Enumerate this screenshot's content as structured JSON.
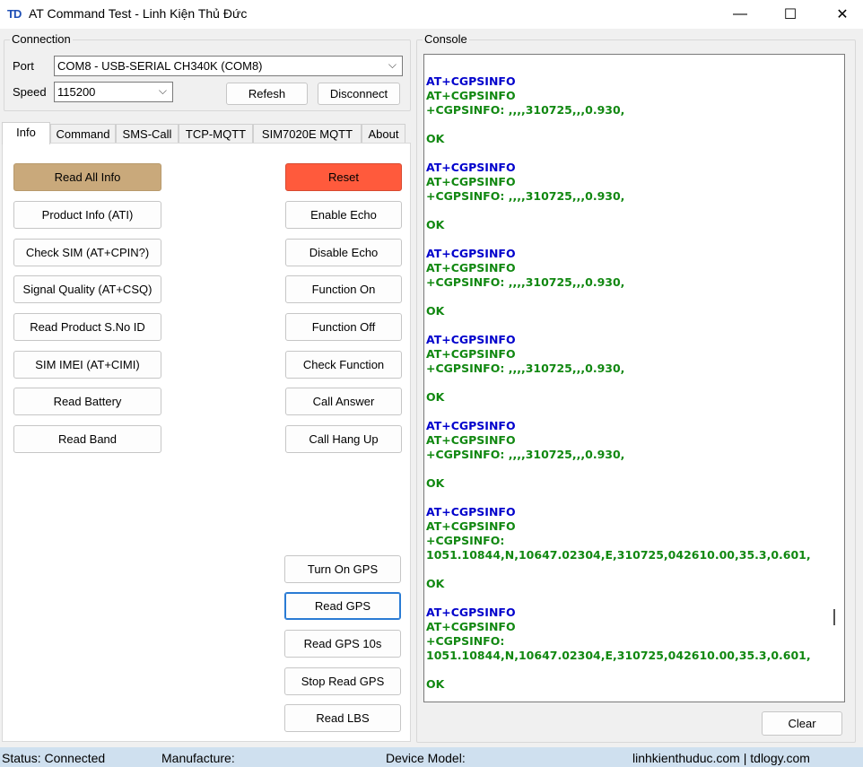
{
  "window": {
    "logo": "TD",
    "title": "AT Command Test - Linh Kiện Thủ Đức",
    "minimize": "—",
    "maximize": "☐",
    "close": "✕"
  },
  "connection": {
    "group_label": "Connection",
    "port_label": "Port",
    "port_value": "COM8 - USB-SERIAL CH340K (COM8)",
    "speed_label": "Speed",
    "speed_value": "115200",
    "refresh_label": "Refesh",
    "disconnect_label": "Disconnect"
  },
  "tabs": [
    "Info",
    "Command",
    "SMS-Call",
    "TCP-MQTT",
    "SIM7020E MQTT",
    "About"
  ],
  "info_left": [
    "Read All Info",
    "Product Info (ATI)",
    "Check SIM (AT+CPIN?)",
    "Signal Quality (AT+CSQ)",
    "Read Product S.No ID",
    "SIM IMEI (AT+CIMI)",
    "Read Battery",
    "Read Band"
  ],
  "info_right": [
    "Reset",
    "Enable Echo",
    "Disable Echo",
    "Function On",
    "Function Off",
    "Check Function",
    "Call Answer",
    "Call Hang Up"
  ],
  "gps_buttons": [
    "Turn On GPS",
    "Read GPS",
    "Read GPS 10s",
    "Stop Read GPS",
    "Read LBS"
  ],
  "colors": {
    "read_all": "#c9a97b",
    "reset": "#ff5a3c",
    "console_command": "#0000cc",
    "console_response": "#118811"
  },
  "console": {
    "group_label": "Console",
    "lines": [
      {
        "t": "",
        "c": "g"
      },
      {
        "t": "AT+CGPSINFO",
        "c": "b"
      },
      {
        "t": "AT+CGPSINFO",
        "c": "g"
      },
      {
        "t": "+CGPSINFO: ,,,,310725,,,0.930,",
        "c": "g"
      },
      {
        "t": "",
        "c": "g"
      },
      {
        "t": "OK",
        "c": "g"
      },
      {
        "t": "",
        "c": "g"
      },
      {
        "t": "AT+CGPSINFO",
        "c": "b"
      },
      {
        "t": "AT+CGPSINFO",
        "c": "g"
      },
      {
        "t": "+CGPSINFO: ,,,,310725,,,0.930,",
        "c": "g"
      },
      {
        "t": "",
        "c": "g"
      },
      {
        "t": "OK",
        "c": "g"
      },
      {
        "t": "",
        "c": "g"
      },
      {
        "t": "AT+CGPSINFO",
        "c": "b"
      },
      {
        "t": "AT+CGPSINFO",
        "c": "g"
      },
      {
        "t": "+CGPSINFO: ,,,,310725,,,0.930,",
        "c": "g"
      },
      {
        "t": "",
        "c": "g"
      },
      {
        "t": "OK",
        "c": "g"
      },
      {
        "t": "",
        "c": "g"
      },
      {
        "t": "AT+CGPSINFO",
        "c": "b"
      },
      {
        "t": "AT+CGPSINFO",
        "c": "g"
      },
      {
        "t": "+CGPSINFO: ,,,,310725,,,0.930,",
        "c": "g"
      },
      {
        "t": "",
        "c": "g"
      },
      {
        "t": "OK",
        "c": "g"
      },
      {
        "t": "",
        "c": "g"
      },
      {
        "t": "AT+CGPSINFO",
        "c": "b"
      },
      {
        "t": "AT+CGPSINFO",
        "c": "g"
      },
      {
        "t": "+CGPSINFO: ,,,,310725,,,0.930,",
        "c": "g"
      },
      {
        "t": "",
        "c": "g"
      },
      {
        "t": "OK",
        "c": "g"
      },
      {
        "t": "",
        "c": "g"
      },
      {
        "t": "AT+CGPSINFO",
        "c": "b"
      },
      {
        "t": "AT+CGPSINFO",
        "c": "g"
      },
      {
        "t": "+CGPSINFO:",
        "c": "g"
      },
      {
        "t": "1051.10844,N,10647.02304,E,310725,042610.00,35.3,0.601,",
        "c": "g"
      },
      {
        "t": "",
        "c": "g"
      },
      {
        "t": "OK",
        "c": "g"
      },
      {
        "t": "",
        "c": "g"
      },
      {
        "t": "AT+CGPSINFO",
        "c": "b"
      },
      {
        "t": "AT+CGPSINFO",
        "c": "g"
      },
      {
        "t": "+CGPSINFO:",
        "c": "g"
      },
      {
        "t": "1051.10844,N,10647.02304,E,310725,042610.00,35.3,0.601,",
        "c": "g"
      },
      {
        "t": "",
        "c": "g"
      },
      {
        "t": "OK",
        "c": "g"
      }
    ],
    "clear_label": "Clear"
  },
  "status": {
    "status": "Status: Connected",
    "manufacture": "Manufacture:",
    "device_model": "Device Model:",
    "website": "linhkienthuduc.com | tdlogy.com"
  }
}
